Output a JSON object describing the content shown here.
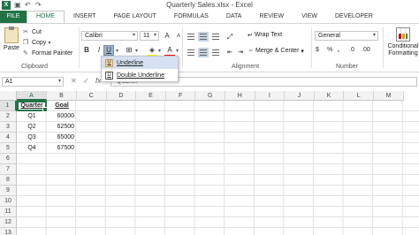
{
  "window": {
    "title": "Quarterly Sales.xlsx - Excel",
    "logo": "X"
  },
  "qat": {
    "save_icon": "save-icon",
    "undo_icon": "undo-icon",
    "redo_icon": "redo-icon"
  },
  "ribbon_tabs": {
    "file": "FILE",
    "items": [
      "HOME",
      "INSERT",
      "PAGE LAYOUT",
      "FORMULAS",
      "DATA",
      "REVIEW",
      "VIEW",
      "DEVELOPER"
    ],
    "active": "HOME"
  },
  "clipboard": {
    "paste": "Paste",
    "cut": "Cut",
    "copy": "Copy",
    "format_painter": "Format Painter",
    "group_label": "Clipboard"
  },
  "font": {
    "name": "Calibri",
    "size": "11",
    "bold": "B",
    "italic": "I",
    "underline": "U",
    "grow": "A",
    "shrink": "A",
    "font_color": "A"
  },
  "alignment": {
    "wrap_text": "Wrap Text",
    "merge_center": "Merge & Center",
    "group_label": "Alignment"
  },
  "number": {
    "format": "General",
    "currency": "$",
    "percent": "%",
    "comma": ",",
    "increase_decimal": ".0",
    "decrease_decimal": ".00",
    "group_label": "Number"
  },
  "styles": {
    "conditional_formatting": "Conditional Formatting"
  },
  "formula_bar": {
    "name_box": "A1",
    "cancel": "✕",
    "enter": "✓",
    "fx": "fx",
    "content": "Quarter"
  },
  "underline_menu": {
    "items": [
      "Underline",
      "Double Underline"
    ]
  },
  "grid": {
    "columns": [
      "A",
      "B",
      "C",
      "D",
      "E",
      "F",
      "G",
      "H",
      "I",
      "J",
      "K",
      "L",
      "M"
    ],
    "rows": [
      "1",
      "2",
      "3",
      "4",
      "5",
      "6",
      "7",
      "8",
      "9",
      "10",
      "11",
      "12",
      "13"
    ],
    "header_row": [
      "Quarter",
      "Goal"
    ],
    "data": [
      [
        "Q1",
        "60000"
      ],
      [
        "Q2",
        "62500"
      ],
      [
        "Q3",
        "65000"
      ],
      [
        "Q4",
        "67500"
      ]
    ]
  },
  "colors": {
    "accent": "#217346",
    "fill_swatch": "#ffff00",
    "font_color_swatch": "#ff0000"
  }
}
